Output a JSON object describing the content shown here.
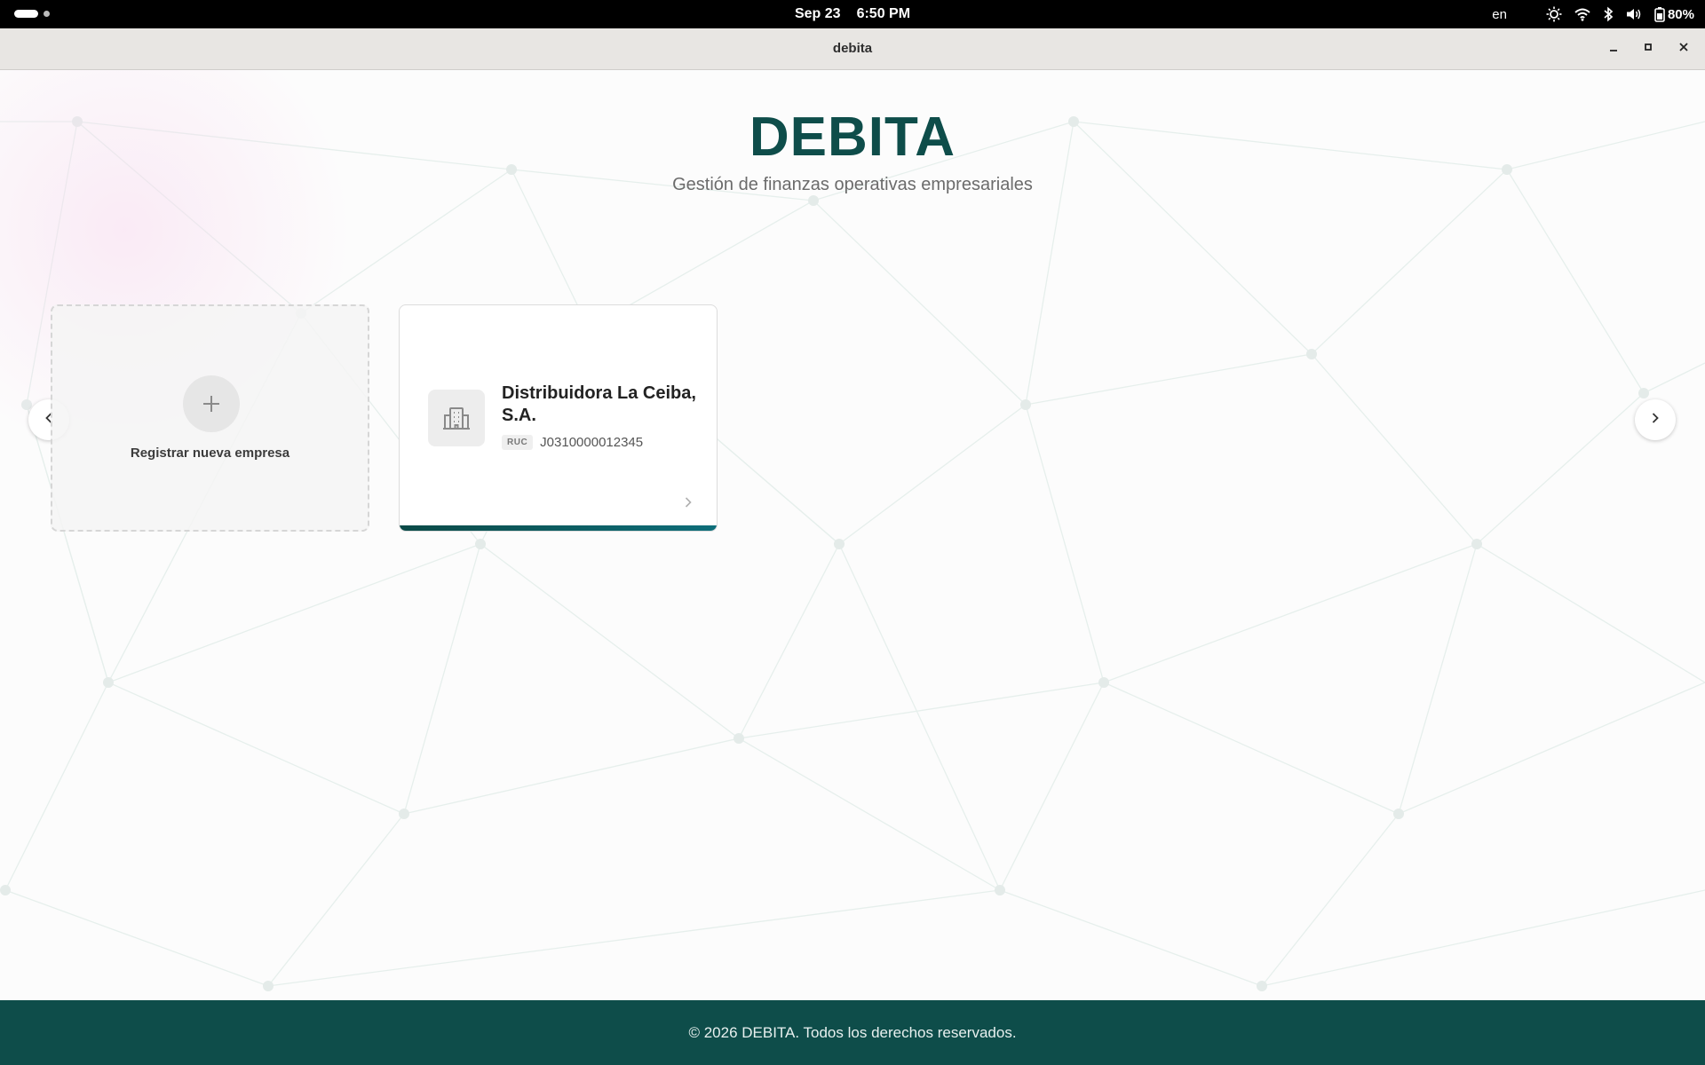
{
  "system_bar": {
    "date": "Sep 23",
    "time": "6:50 PM",
    "language": "en",
    "battery": "80%"
  },
  "window": {
    "title": "debita"
  },
  "app": {
    "title": "DEBITA",
    "subtitle": "Gestión de finanzas operativas empresariales"
  },
  "carousel": {
    "new_company_label": "Registrar nueva empresa",
    "companies": [
      {
        "name": "Distribuidora La Ceiba, S.A.",
        "ruc_label": "RUC",
        "ruc": "J0310000012345"
      }
    ]
  },
  "footer": {
    "text": "© 2026 DEBITA. Todos los derechos reservados."
  },
  "colors": {
    "brand": "#0e4d4a",
    "accent": "#0e6e7a"
  },
  "icons": {
    "new_company": "plus-icon",
    "company_logo": "building-icon",
    "prev": "chevron-left-icon",
    "next": "chevron-right-icon"
  }
}
